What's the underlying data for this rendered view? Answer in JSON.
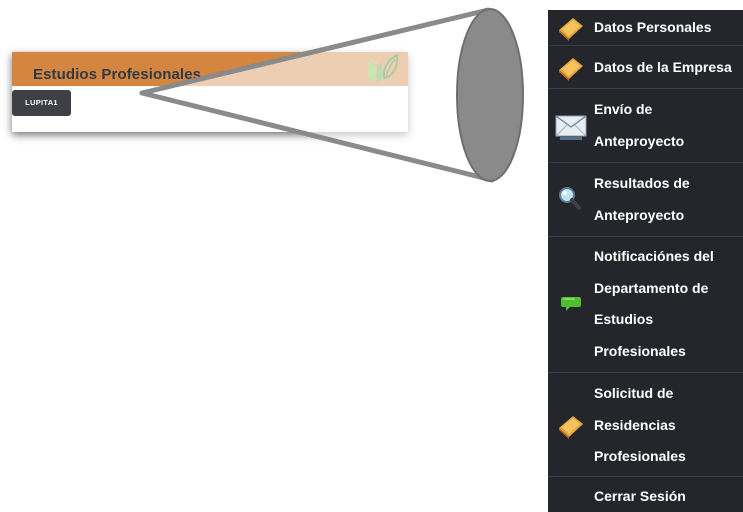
{
  "header": {
    "title": "Estudios Profesionales",
    "bar_color": "#d4853f",
    "logo_icon": "book-leaf-logo",
    "user_button_label": "LUPITA1"
  },
  "zoom": {
    "description_icon": "magnifier-cone"
  },
  "sidebar": {
    "background": "#24262c",
    "items": [
      {
        "label": "Datos Personales",
        "icon": "book-icon"
      },
      {
        "label": "Datos de la Empresa",
        "icon": "book-icon"
      },
      {
        "label": "Envío de Anteproyecto",
        "icon": "mail-icon"
      },
      {
        "label": "Resultados de Anteproyecto",
        "icon": "magnifier-icon"
      },
      {
        "label": "Notificaciónes del Departamento de Estudios Profesionales",
        "icon": "chat-bubble-icon"
      },
      {
        "label": "Solicitud de Residencias Profesionales",
        "icon": "book-icon"
      },
      {
        "label": "Cerrar Sesión",
        "icon": ""
      }
    ]
  }
}
